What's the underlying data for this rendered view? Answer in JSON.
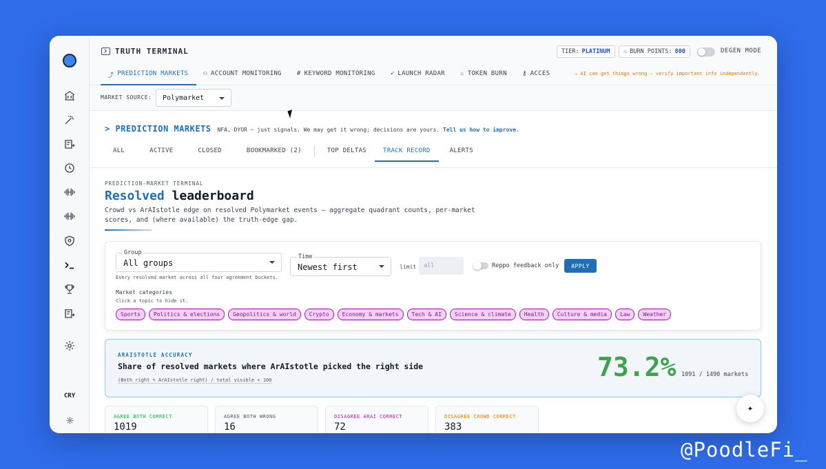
{
  "app": {
    "title": "TRUTH TERMINAL",
    "tier_label": "TIER:",
    "tier_value": "PLATINUM",
    "burn_label": "BURN POINTS:",
    "burn_value": "800",
    "degen_label": "DEGEN MODE",
    "warning": "⚠ AI can get things wrong — verify important info independently."
  },
  "nav": {
    "tabs": [
      {
        "icon": "trend-icon",
        "glyph": "⤴",
        "label": "PREDICTION MARKETS"
      },
      {
        "icon": "account-icon",
        "glyph": "⚇",
        "label": "ACCOUNT MONITORING"
      },
      {
        "icon": "hash-icon",
        "glyph": "#",
        "label": "KEYWORD MONITORING"
      },
      {
        "icon": "rocket-icon",
        "glyph": "➶",
        "label": "LAUNCH RADAR"
      },
      {
        "icon": "flame-icon",
        "glyph": "♨",
        "label": "TOKEN BURN"
      },
      {
        "icon": "key-icon",
        "glyph": "⚷",
        "label": "ACCES"
      }
    ]
  },
  "source": {
    "label": "MARKET SOURCE:",
    "value": "Polymarket"
  },
  "section": {
    "title": "> PREDICTION MARKETS",
    "note": "NFA, DYOR — just signals. We may get it wrong; decisions are yours.",
    "link": "Tell us how to improve."
  },
  "subtabs": [
    "ALL",
    "ACTIVE",
    "CLOSED",
    "BOOKMARKED (2)",
    "TOP DELTAS",
    "TRACK RECORD",
    "ALERTS"
  ],
  "board": {
    "eyebrow": "PREDICTION-MARKET TERMINAL",
    "title_accent": "Resolved",
    "title_rest": "leaderboard",
    "description": "Crowd vs ArAIstotle edge on resolved Polymarket events — aggregate quadrant counts, per-market scores, and (where available) the truth-edge gap."
  },
  "filters": {
    "group_label": "Group",
    "group_value": "All groups",
    "group_help": "Every resolved market across all four agreement buckets.",
    "time_label": "Time",
    "time_value": "Newest first",
    "limit_label": "limit",
    "limit_placeholder": "all",
    "reppo_label": "Reppo feedback only",
    "apply_label": "APPLY",
    "categories_title": "Market categories",
    "categories_help": "Click a topic to hide it.",
    "categories": [
      "Sports",
      "Politics & elections",
      "Geopolitics & world",
      "Crypto",
      "Economy & markets",
      "Tech & AI",
      "Science & climate",
      "Health",
      "Culture & media",
      "Law",
      "Weather"
    ]
  },
  "accuracy": {
    "eyebrow": "ARAISTOTLE ACCURACY",
    "title": "Share of resolved markets where ArAIstotle picked the right side",
    "formula": "(Both right + ArAIstotle right) / total visible × 100",
    "value": "73.2%",
    "markets": "1091 / 1490 markets"
  },
  "stats": [
    {
      "label": "AGREE BOTH CORRECT",
      "value": "1019",
      "color": "#22a447"
    },
    {
      "label": "AGREE BOTH WRONG",
      "value": "16",
      "color": "#4b5563"
    },
    {
      "label": "DISAGREE ARAI CORRECT",
      "value": "72",
      "color": "#a21caf"
    },
    {
      "label": "DISAGREE CROWD CORRECT",
      "value": "383",
      "color": "#d97706"
    }
  ],
  "sidebar": {
    "bottom_label": "CRY"
  },
  "watermark": "@PoodleFi_"
}
